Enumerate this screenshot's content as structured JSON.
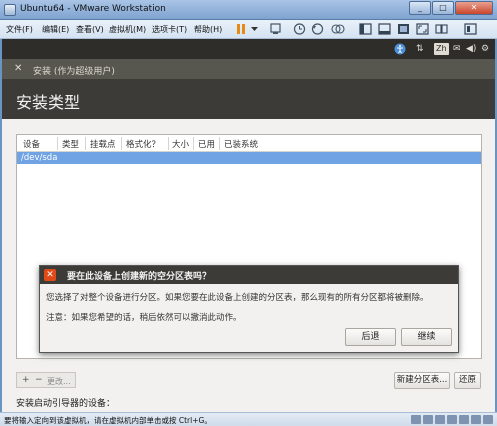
{
  "window": {
    "title": "Ubuntu64 - VMware Workstation"
  },
  "menubar": {
    "items": [
      "文件(F)",
      "编辑(E)",
      "查看(V)",
      "虚拟机(M)",
      "选项卡(T)",
      "帮助(H)"
    ]
  },
  "ubuntu_panel": {
    "lang": "Zh"
  },
  "installer": {
    "header": "安装 (作为超级用户)",
    "title": "安装类型",
    "table": {
      "columns": [
        "设备",
        "类型",
        "挂载点",
        "格式化？",
        "大小",
        "已用",
        "已装系统"
      ],
      "rows": [
        {
          "device": "/dev/sda"
        }
      ]
    },
    "add": "+",
    "remove": "−",
    "change": "更改...",
    "new_table_button": "新建分区表...",
    "revert_button": "还原",
    "boot_loader_label": "安装启动引导器的设备："
  },
  "dialog": {
    "title": "要在此设备上创建新的空分区表吗？",
    "message1": "您选择了对整个设备进行分区。如果您要在此设备上创建的分区表，那么现有的所有分区都将被删除。",
    "message2": "注意：如果您希望的话，稍后依然可以撤消此动作。",
    "back_button": "后退",
    "continue_button": "继续"
  },
  "statusbar": {
    "message": "要将输入定向到该虚拟机，请在虚拟机内部单击或按 Ctrl+G。"
  },
  "colors": {
    "ubuntu_orange": "#df4a16",
    "selection_blue": "#6fa3e3",
    "ubuntu_dark": "#3c3b37"
  }
}
